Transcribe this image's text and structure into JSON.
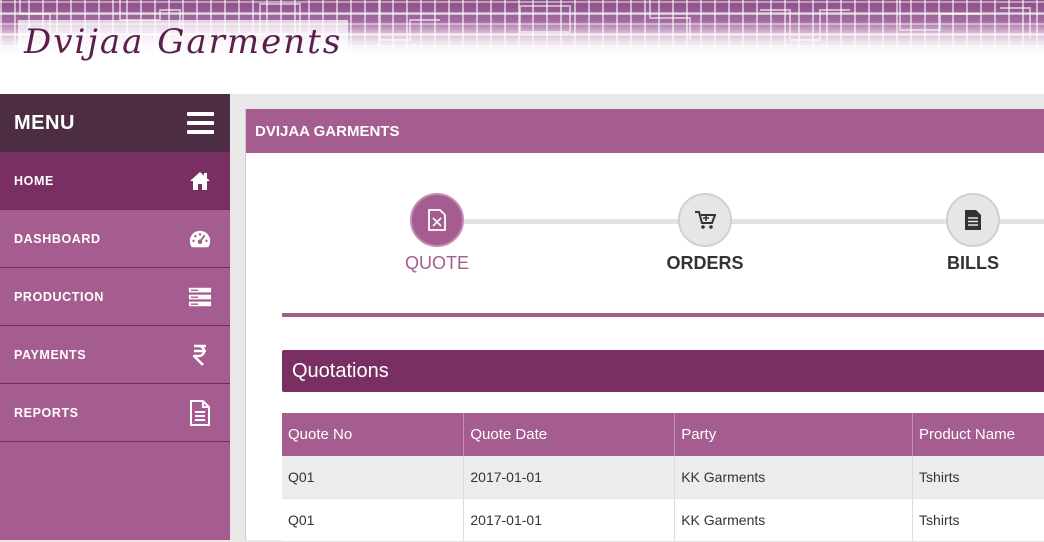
{
  "brand": {
    "logo_text": "Dvijaa Garments"
  },
  "sidebar": {
    "menu_label": "MENU",
    "items": [
      {
        "label": "HOME",
        "icon": "home-icon"
      },
      {
        "label": "DASHBOARD",
        "icon": "speedometer-icon"
      },
      {
        "label": "PRODUCTION",
        "icon": "server-icon"
      },
      {
        "label": "PAYMENTS",
        "icon": "rupee-icon"
      },
      {
        "label": "REPORTS",
        "icon": "document-icon"
      }
    ]
  },
  "panel": {
    "title": "DVIJAA GARMENTS",
    "steps": [
      {
        "label": "QUOTE",
        "icon": "quote-file-icon"
      },
      {
        "label": "ORDERS",
        "icon": "cart-icon"
      },
      {
        "label": "BILLS",
        "icon": "bill-icon"
      }
    ],
    "active_step": "QUOTE",
    "section_title": "Quotations",
    "table": {
      "columns": [
        "Quote No",
        "Quote Date",
        "Party",
        "Product Name"
      ],
      "rows": [
        [
          "Q01",
          "2017-01-01",
          "KK Garments",
          "Tshirts"
        ],
        [
          "Q01",
          "2017-01-01",
          "KK Garments",
          "Tshirts"
        ]
      ]
    }
  },
  "colors": {
    "primary": "#a55c8f",
    "dark": "#7a2f62",
    "menu_header": "#4d2d44"
  }
}
